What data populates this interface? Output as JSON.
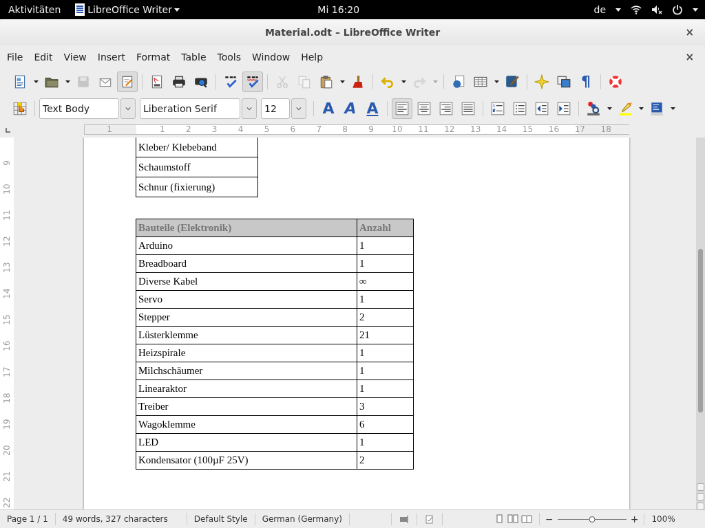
{
  "top_bar": {
    "activities": "Aktivitäten",
    "app_menu": "LibreOffice Writer",
    "clock": "Mi 16:20",
    "keyboard_layout": "de"
  },
  "window": {
    "title": "Material.odt – LibreOffice Writer",
    "close": "×"
  },
  "menu_bar": {
    "items": [
      "File",
      "Edit",
      "View",
      "Insert",
      "Format",
      "Table",
      "Tools",
      "Window",
      "Help"
    ],
    "close": "×"
  },
  "standard_toolbar": [
    {
      "kind": "new",
      "dropdown": true,
      "pressed": false,
      "disabled": false
    },
    {
      "kind": "open",
      "dropdown": true,
      "pressed": false,
      "disabled": false
    },
    {
      "kind": "save",
      "dropdown": false,
      "pressed": false,
      "disabled": true
    },
    {
      "kind": "email",
      "dropdown": false,
      "pressed": false,
      "disabled": false
    },
    {
      "kind": "edit",
      "dropdown": false,
      "pressed": true,
      "disabled": false
    },
    {
      "kind": "separator"
    },
    {
      "kind": "pdf",
      "dropdown": false,
      "pressed": false,
      "disabled": false
    },
    {
      "kind": "print",
      "dropdown": false,
      "pressed": false,
      "disabled": false
    },
    {
      "kind": "preview",
      "dropdown": false,
      "pressed": false,
      "disabled": false
    },
    {
      "kind": "separator"
    },
    {
      "kind": "spelling",
      "dropdown": false,
      "pressed": false,
      "disabled": false
    },
    {
      "kind": "autospell",
      "dropdown": false,
      "pressed": true,
      "disabled": false
    },
    {
      "kind": "separator"
    },
    {
      "kind": "cut",
      "dropdown": false,
      "pressed": false,
      "disabled": true
    },
    {
      "kind": "copy",
      "dropdown": false,
      "pressed": false,
      "disabled": true
    },
    {
      "kind": "paste",
      "dropdown": true,
      "pressed": false,
      "disabled": false
    },
    {
      "kind": "brush",
      "dropdown": false,
      "pressed": false,
      "disabled": false
    },
    {
      "kind": "separator"
    },
    {
      "kind": "undo",
      "dropdown": true,
      "pressed": false,
      "disabled": false
    },
    {
      "kind": "redo",
      "dropdown": true,
      "pressed": false,
      "disabled": true
    },
    {
      "kind": "separator"
    },
    {
      "kind": "globe",
      "dropdown": false,
      "pressed": false,
      "disabled": false
    },
    {
      "kind": "table",
      "dropdown": true,
      "pressed": false,
      "disabled": false
    },
    {
      "kind": "draw",
      "dropdown": false,
      "pressed": false,
      "disabled": false
    },
    {
      "kind": "separator"
    },
    {
      "kind": "star",
      "dropdown": false,
      "pressed": false,
      "disabled": false
    },
    {
      "kind": "gallery",
      "dropdown": false,
      "pressed": false,
      "disabled": false
    },
    {
      "kind": "glyph",
      "label": "¶",
      "dropdown": false,
      "pressed": false,
      "disabled": false
    },
    {
      "kind": "separator"
    },
    {
      "kind": "help",
      "dropdown": false,
      "pressed": false,
      "disabled": false
    }
  ],
  "formatting_toolbar": [
    {
      "kind": "styles",
      "dropdown": false,
      "pressed": false,
      "disabled": false
    },
    {
      "kind": "separator"
    },
    {
      "kind": "style_combo",
      "value": "Text Body"
    },
    {
      "kind": "font_combo",
      "value": "Liberation Serif"
    },
    {
      "kind": "size_combo",
      "value": "12"
    },
    {
      "kind": "separator"
    },
    {
      "kind": "glyph",
      "label": "A",
      "dropdown": false,
      "pressed": false,
      "disabled": false
    },
    {
      "kind": "glyph_italic",
      "label": "A",
      "dropdown": false,
      "pressed": false,
      "disabled": false
    },
    {
      "kind": "glyph_underline",
      "label": "A",
      "dropdown": false,
      "pressed": false,
      "disabled": false
    },
    {
      "kind": "separator"
    },
    {
      "kind": "align_left",
      "dropdown": false,
      "pressed": true,
      "disabled": false
    },
    {
      "kind": "align_center",
      "dropdown": false,
      "pressed": false,
      "disabled": false
    },
    {
      "kind": "align_right",
      "dropdown": false,
      "pressed": false,
      "disabled": false
    },
    {
      "kind": "justify",
      "dropdown": false,
      "pressed": false,
      "disabled": false
    },
    {
      "kind": "separator"
    },
    {
      "kind": "numbering",
      "dropdown": false,
      "pressed": false,
      "disabled": false
    },
    {
      "kind": "bullets",
      "dropdown": false,
      "pressed": false,
      "disabled": false
    },
    {
      "kind": "outdent",
      "dropdown": false,
      "pressed": false,
      "disabled": false
    },
    {
      "kind": "indent",
      "dropdown": false,
      "pressed": false,
      "disabled": false
    },
    {
      "kind": "separator"
    },
    {
      "kind": "font_color",
      "dropdown": true,
      "pressed": false,
      "disabled": false
    },
    {
      "kind": "highlight",
      "dropdown": true,
      "pressed": false,
      "disabled": false
    },
    {
      "kind": "background",
      "dropdown": true,
      "pressed": false,
      "disabled": false
    }
  ],
  "ruler": {
    "left_margin_label": "1",
    "labels": [
      "1",
      "2",
      "3",
      "4",
      "5",
      "6",
      "7",
      "8",
      "9",
      "10",
      "11",
      "12",
      "13",
      "14",
      "15",
      "16",
      "17",
      "18"
    ]
  },
  "vertical_ruler": {
    "labels": [
      "9",
      "10",
      "11",
      "12",
      "13",
      "14",
      "15",
      "16",
      "17",
      "18",
      "19",
      "20",
      "21",
      "22"
    ]
  },
  "document": {
    "table_1": {
      "rows": [
        "Kleber/ Klebeband",
        "Schaumstoff",
        "Schnur (fixierung)"
      ]
    },
    "table_2": {
      "columns": [
        "Bauteile (Elektronik)",
        "Anzahl"
      ],
      "rows": [
        [
          "Arduino",
          "1"
        ],
        [
          "Breadboard",
          "1"
        ],
        [
          "Diverse Kabel",
          "∞"
        ],
        [
          "Servo",
          "1"
        ],
        [
          "Stepper",
          "2"
        ],
        [
          "Lüsterklemme",
          "21"
        ],
        [
          "Heizspirale",
          "1"
        ],
        [
          "Milchschäumer",
          "1"
        ],
        [
          "Linearaktor",
          "1"
        ],
        [
          "Treiber",
          "3"
        ],
        [
          "Wagoklemme",
          "6"
        ],
        [
          "LED",
          "1"
        ],
        [
          "Kondensator (100µF 25V)",
          "2"
        ]
      ]
    }
  },
  "status_bar": {
    "page": "Page 1 / 1",
    "word_count": "49 words, 327 characters",
    "page_style": "Default Style",
    "language": "German (Germany)",
    "zoom_out": "−",
    "zoom_in": "+",
    "zoom": {
      "level": 0.5
    },
    "zoom_percent": "100%"
  }
}
